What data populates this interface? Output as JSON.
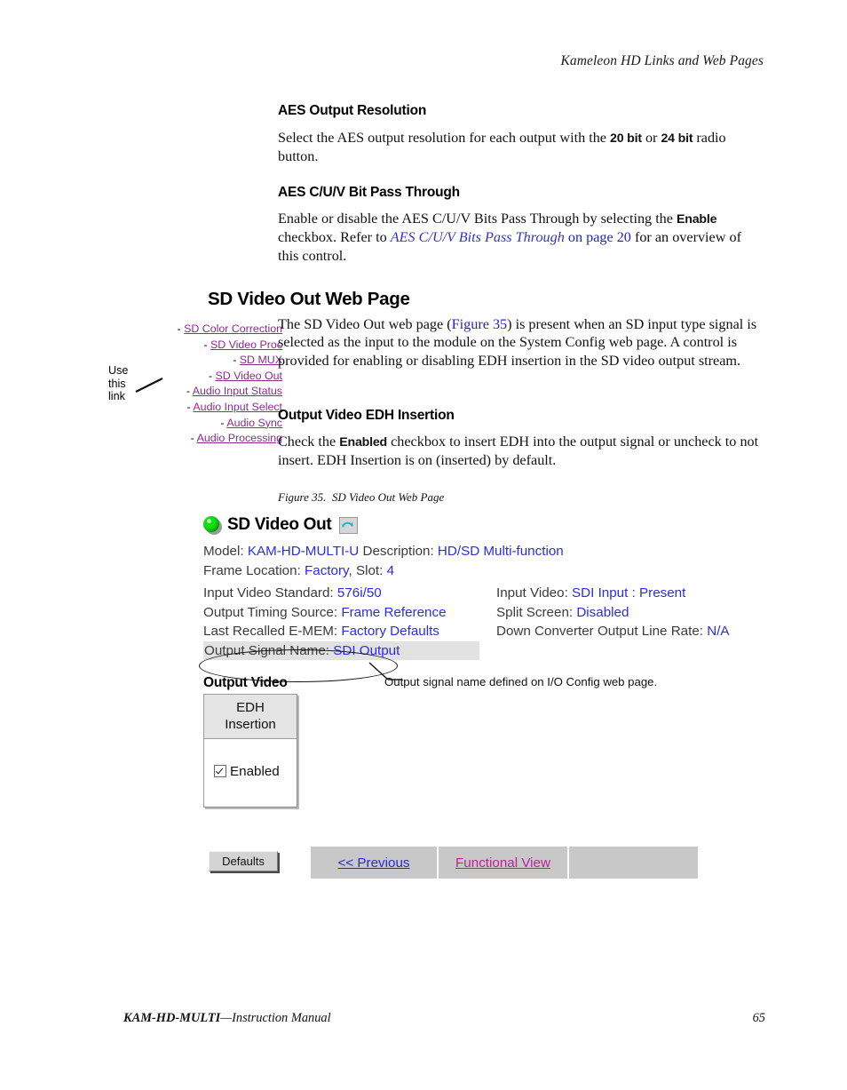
{
  "running_head": "Kameleon HD Links and Web Pages",
  "sections": [
    {
      "heading": "AES Output Resolution",
      "para_parts": [
        {
          "t": "Select the AES output resolution for each output with the ",
          "s": "plain"
        },
        {
          "t": "20 bit",
          "s": "bold"
        },
        {
          "t": " or ",
          "s": "plain"
        },
        {
          "t": "24 bit",
          "s": "bold"
        },
        {
          "t": " radio button.",
          "s": "plain"
        }
      ]
    },
    {
      "heading": "AES C/U/V Bit Pass Through",
      "para_parts": [
        {
          "t": "Enable or disable the AES C/U/V Bits Pass Through by selecting the ",
          "s": "plain"
        },
        {
          "t": "Enable",
          "s": "bold"
        },
        {
          "t": " checkbox. Refer to ",
          "s": "plain"
        },
        {
          "t": "AES C/U/V Bits Pass Through",
          "s": "xref-italic"
        },
        {
          "t": " on page 20",
          "s": "xref"
        },
        {
          "t": " for an overview of this control.",
          "s": "plain"
        }
      ]
    }
  ],
  "main_heading": "SD Video Out Web Page",
  "intro_parts": [
    {
      "t": "The SD Video Out web page (",
      "s": "plain"
    },
    {
      "t": "Figure 35",
      "s": "xref"
    },
    {
      "t": ") is present when an SD input type signal is selected as the input to the module on the System Config web page. A control is provided for enabling or disabling EDH insertion in the SD video output stream.",
      "s": "plain"
    }
  ],
  "subsection": {
    "heading": "Output Video EDH Insertion",
    "para_parts": [
      {
        "t": "Check the ",
        "s": "plain"
      },
      {
        "t": "Enabled",
        "s": "bold"
      },
      {
        "t": " checkbox to insert EDH into the output signal or uncheck to not insert. EDH Insertion is on (inserted) by default.",
        "s": "plain"
      }
    ]
  },
  "nav": {
    "dash": "-",
    "links": [
      "SD Color Correction",
      "SD Video Proc",
      "SD MUX",
      "SD Video Out",
      "Audio Input Status",
      "Audio Input Select",
      "Audio Sync",
      "Audio Processing"
    ],
    "annotation_lines": [
      "Use",
      "this",
      "link"
    ]
  },
  "figure": {
    "caption_number": "Figure 35.",
    "caption_title": "SD Video Out Web Page"
  },
  "screenshot": {
    "page_title": "SD Video Out",
    "led_state": "green",
    "refresh_icon": "refresh-icon",
    "model_label": "Model:",
    "model_value": "KAM-HD-MULTI-U",
    "description_label": "Description:",
    "description_value": "HD/SD Multi-function",
    "frame_location_label": "Frame Location:",
    "frame_location_value": "Factory",
    "slot_label": ", Slot:",
    "slot_value": "4",
    "rows": [
      {
        "left_label": "Input Video Standard:",
        "left_value": "576i/50",
        "right_label": "Input Video:",
        "right_value": "SDI Input : Present"
      },
      {
        "left_label": "Output Timing Source:",
        "left_value": "Frame Reference",
        "right_label": "Split Screen:",
        "right_value": "Disabled"
      },
      {
        "left_label": "Last Recalled E-MEM:",
        "left_value": "Factory Defaults",
        "right_label": "Down Converter Output Line Rate:",
        "right_value": "N/A"
      }
    ],
    "signal_name_label": "Output Signal Name:",
    "signal_name_value": "SDI Output",
    "callout_text": "Output signal name defined on I/O Config web page.",
    "output_video_label": "Output Video",
    "edh_header_line1": "EDH",
    "edh_header_line2": "Insertion",
    "edh_checkbox_label": "Enabled",
    "edh_checked": true,
    "defaults_button": "Defaults",
    "previous_button": "<< Previous",
    "functional_button": "Functional View",
    "blank_button": ""
  },
  "footer": {
    "manual_bold": "KAM-HD-MULTI",
    "manual_rest": "—Instruction Manual",
    "page_number": "65"
  },
  "colors": {
    "link_purple": "#8e2a8e",
    "link_blue": "#2b2bcc",
    "value_blue": "#2b2bf0",
    "led_green": "#12e012",
    "xref_blue": "#2222cc",
    "button_gray": "#c8c8c8",
    "highlight_gray": "#e2e2e2"
  }
}
